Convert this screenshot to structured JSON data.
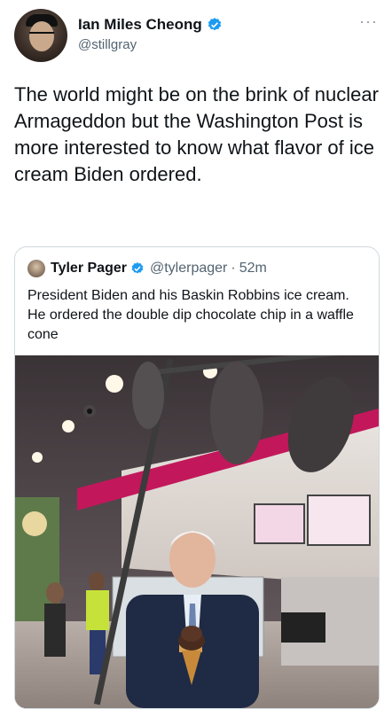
{
  "author": {
    "display_name": "Ian Miles Cheong",
    "handle": "@stillgray",
    "verified_icon": "verified-badge-icon",
    "avatar_icon": "avatar"
  },
  "tweet": {
    "text": "The world might be on the brink of nuclear Armageddon but the Washington Post is more interested to know what flavor of ice cream Biden ordered."
  },
  "more_icon": "more-dots-icon",
  "quote": {
    "display_name": "Tyler Pager",
    "handle": "@tylerpager",
    "separator": "·",
    "time": "52m",
    "text": "President Biden and his Baskin Robbins ice cream. He ordered the double dip chocolate chip in a waffle cone"
  },
  "colors": {
    "verified": "#1d9bf0",
    "muted_text": "#536471",
    "border": "#cfd9de",
    "accent_pink": "#c2185b"
  }
}
